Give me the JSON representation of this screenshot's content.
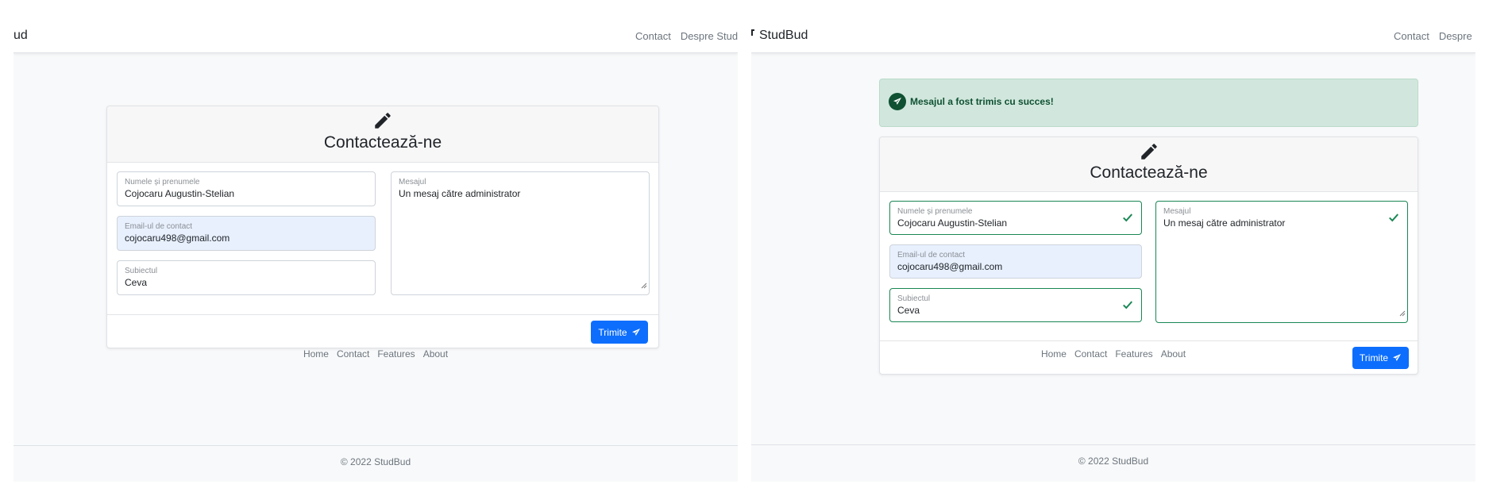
{
  "left": {
    "navbar": {
      "brand": "ud",
      "links": [
        "Contact",
        "Despre StudBu"
      ]
    },
    "form": {
      "title": "Contactează-ne",
      "name_label": "Numele și prenumele",
      "name_value": "Cojocaru Augustin-Stelian",
      "email_label": "Email-ul de contact",
      "email_value": "cojocaru498@gmail.com",
      "subject_label": "Subiectul",
      "subject_value": "Ceva",
      "message_label": "Mesajul",
      "message_value": "Un mesaj către administrator",
      "submit_label": "Trimite"
    },
    "footer": {
      "links": [
        "Home",
        "Contact",
        "Features",
        "About"
      ],
      "copyright": "© 2022 StudBud"
    }
  },
  "right": {
    "navbar": {
      "brand": "StudBud",
      "links": [
        "Contact",
        "Despre St"
      ]
    },
    "alert": {
      "text": "Mesajul a fost trimis cu succes!"
    },
    "form": {
      "title": "Contactează-ne",
      "name_label": "Numele și prenumele",
      "name_value": "Cojocaru Augustin-Stelian",
      "email_label": "Email-ul de contact",
      "email_value": "cojocaru498@gmail.com",
      "subject_label": "Subiectul",
      "subject_value": "Ceva",
      "message_label": "Mesajul",
      "message_value": "Un mesaj către administrator",
      "submit_label": "Trimite"
    },
    "footer": {
      "links": [
        "Home",
        "Contact",
        "Features",
        "About"
      ],
      "copyright": "© 2022 StudBud"
    }
  },
  "colors": {
    "primary": "#0d6efd",
    "success": "#198754",
    "alert_bg": "#d1e7dd",
    "alert_text": "#0f5132",
    "autofill_bg": "#e8f0fe"
  },
  "icons": {
    "edit": "pencil-icon",
    "send": "paper-plane-icon",
    "valid": "check-icon",
    "alert": "telegram-icon"
  }
}
